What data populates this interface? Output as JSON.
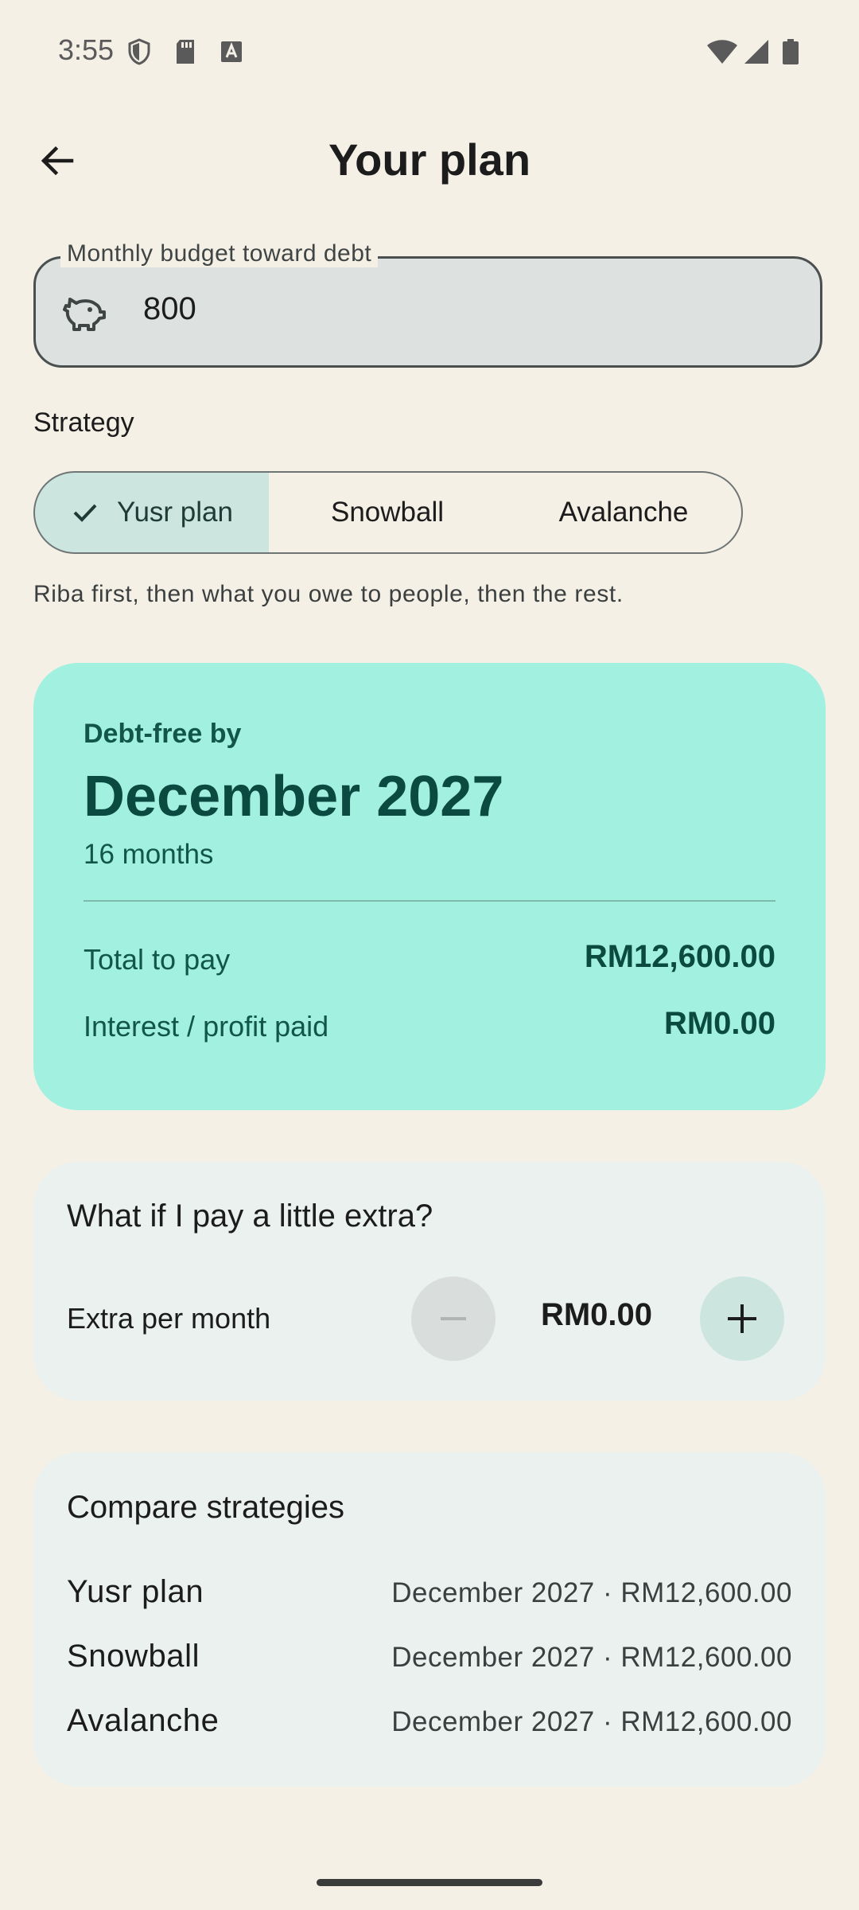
{
  "status_bar": {
    "time": "3:55",
    "left_icons": [
      "shield-icon",
      "sd-card-icon",
      "keyboard-a-icon"
    ],
    "right_icons": [
      "wifi-icon",
      "signal-icon",
      "battery-icon"
    ]
  },
  "app_bar": {
    "back_icon": "arrow-left-icon",
    "title": "Your plan"
  },
  "budget": {
    "label": "Monthly budget toward debt",
    "value": "800",
    "icon": "piggy-bank-icon"
  },
  "strategy": {
    "heading": "Strategy",
    "options": [
      {
        "label": "Yusr plan",
        "selected": true
      },
      {
        "label": "Snowball",
        "selected": false
      },
      {
        "label": "Avalanche",
        "selected": false
      }
    ],
    "description": "Riba first, then what you owe to people, then the rest."
  },
  "result": {
    "label": "Debt-free by",
    "date": "December 2027",
    "duration": "16 months",
    "rows": [
      {
        "label": "Total to pay",
        "value": "RM12,600.00"
      },
      {
        "label": "Interest / profit paid",
        "value": "RM0.00"
      }
    ]
  },
  "extra": {
    "title": "What if I pay a little extra?",
    "label": "Extra per month",
    "value": "RM0.00"
  },
  "compare": {
    "title": "Compare strategies",
    "rows": [
      {
        "name": "Yusr plan",
        "value": "December 2027 · RM12,600.00"
      },
      {
        "name": "Snowball",
        "value": "December 2027 · RM12,600.00"
      },
      {
        "name": "Avalanche",
        "value": "December 2027 · RM12,600.00"
      }
    ]
  },
  "colors": {
    "background": "#f5f0e6",
    "result_card": "#a1f0e0",
    "selected_segment": "#cce6df",
    "secondary_card": "#eaf1ef",
    "accent_text": "#0b4a40"
  }
}
